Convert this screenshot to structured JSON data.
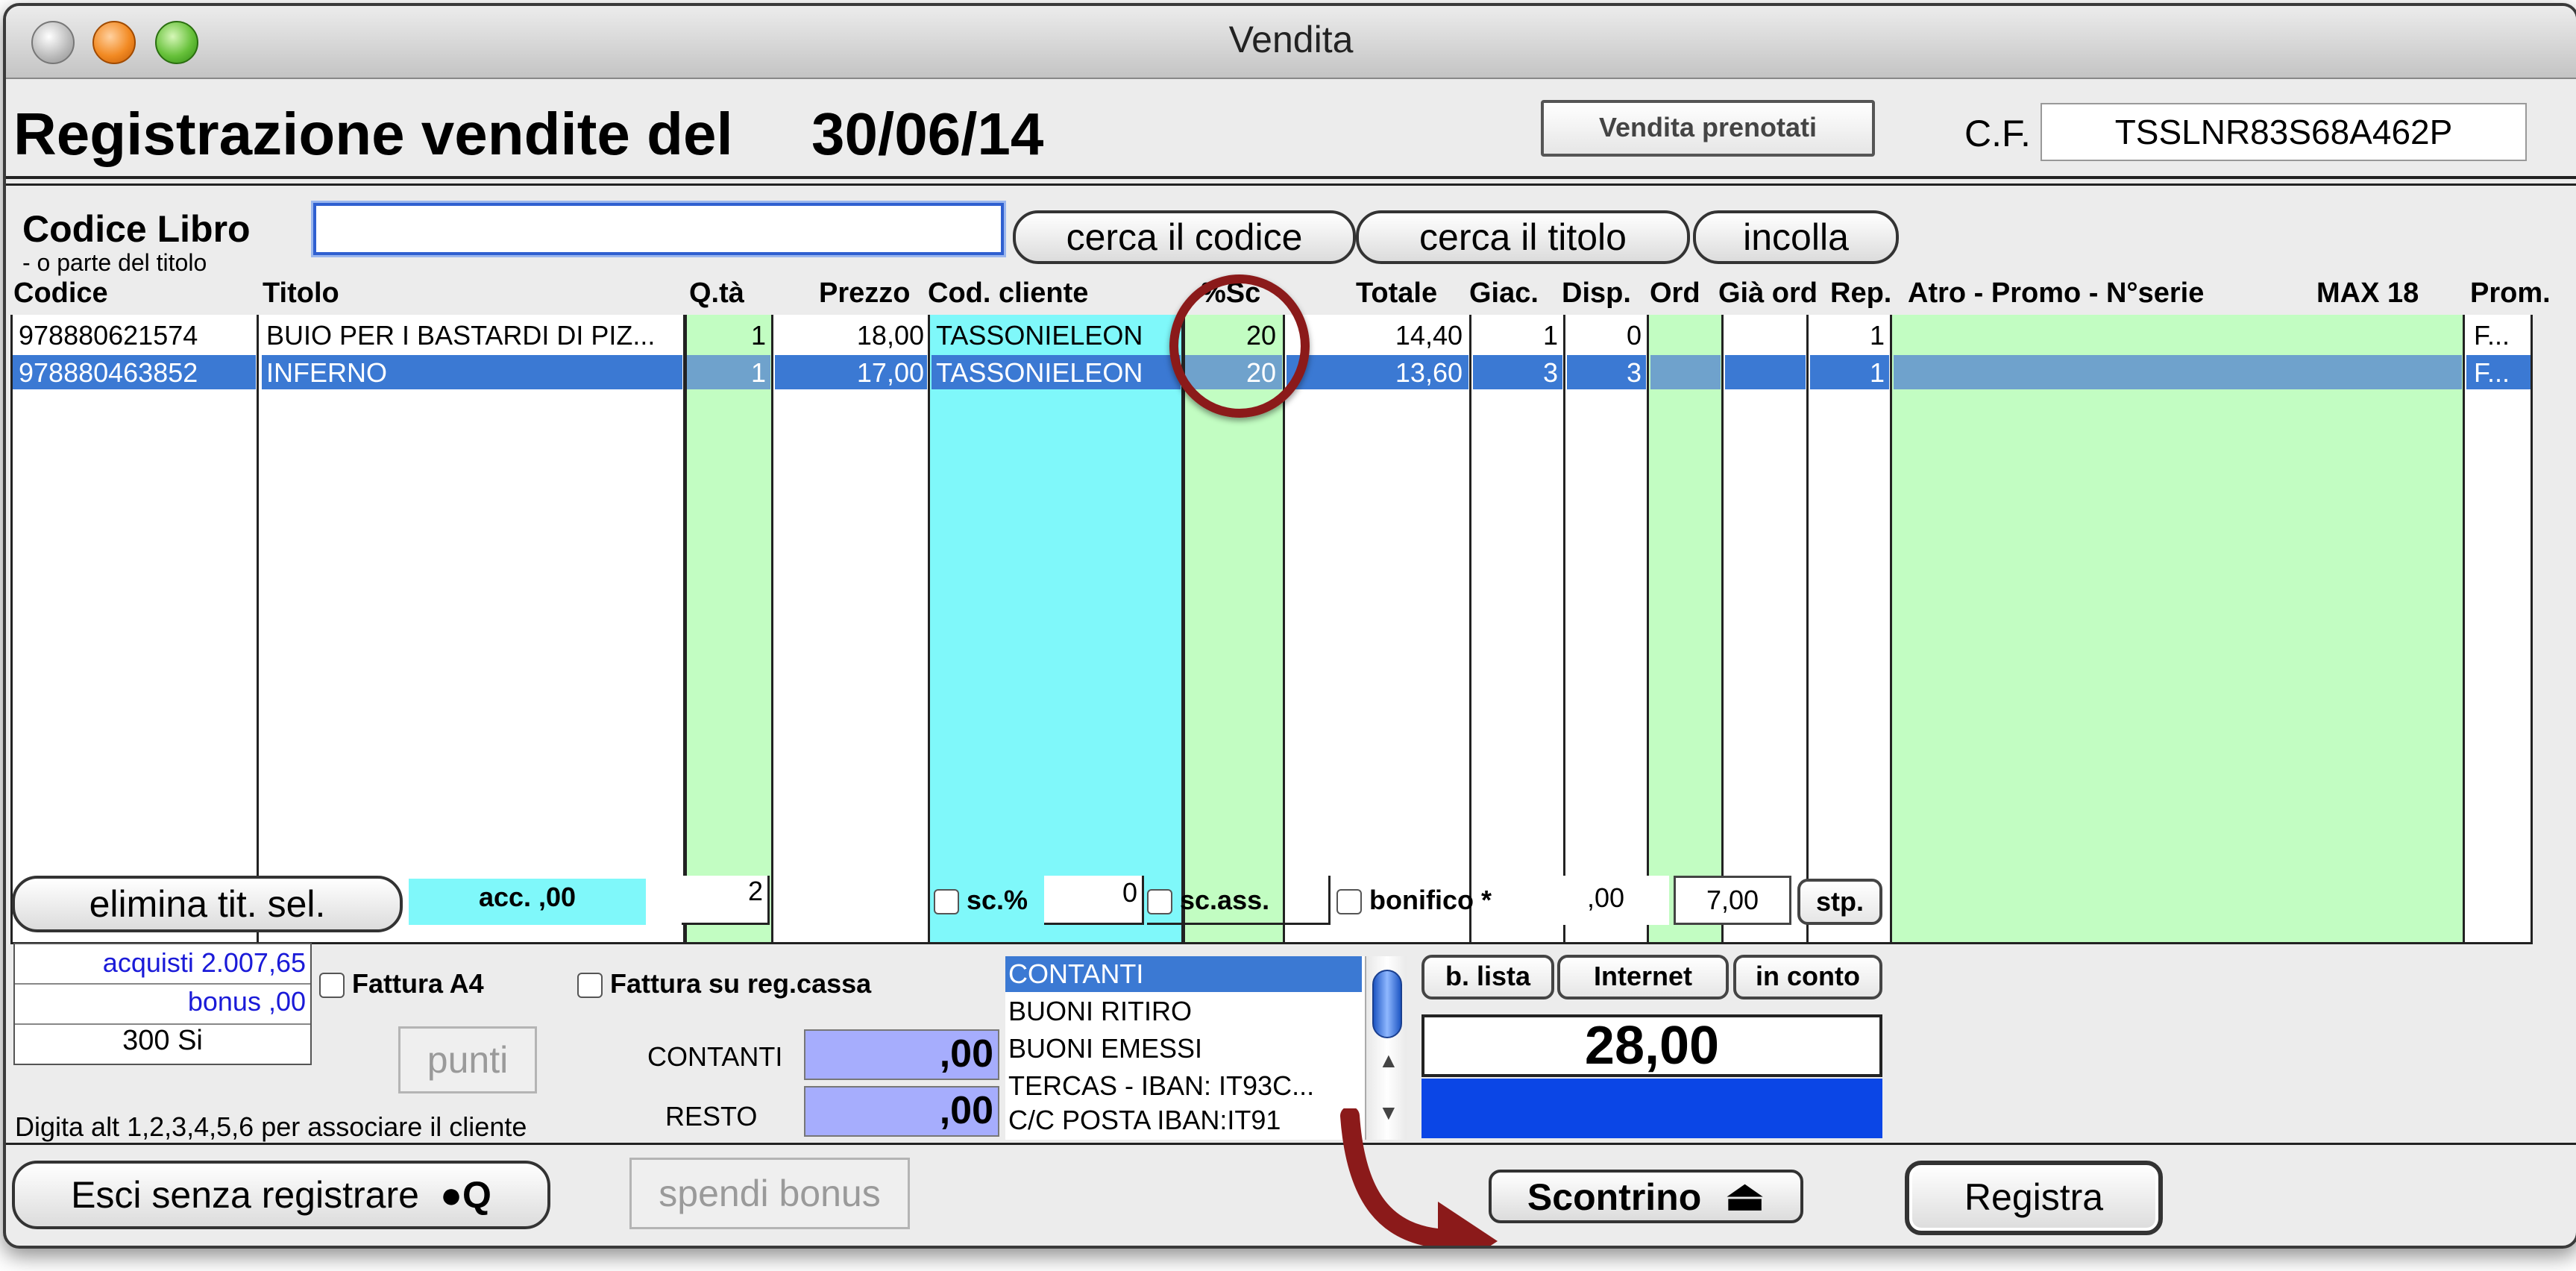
{
  "window": {
    "title": "Vendita"
  },
  "header": {
    "title": "Registrazione vendite del",
    "date": "30/06/14",
    "vendita_prenotati_label": "Vendita prenotati",
    "cf_label": "C.F.",
    "cf_value": "TSSLNR83S68A462P"
  },
  "search": {
    "label": "Codice Libro",
    "sublabel": "- o parte del  titolo",
    "value": "",
    "cerca_codice_label": "cerca il codice",
    "cerca_titolo_label": "cerca il titolo",
    "incolla_label": "incolla"
  },
  "table": {
    "columns": [
      "Codice",
      "Titolo",
      "Q.tà",
      "Prezzo",
      "Cod. cliente",
      "%Sc",
      "Totale",
      "Giac.",
      "Disp.",
      "Ord",
      "Già ord",
      "Rep.",
      "Atro - Promo - N°serie",
      "MAX 18",
      "Prom."
    ],
    "rows": [
      {
        "codice": "978880621574",
        "titolo": "BUIO PER I BASTARDI DI PIZ...",
        "qta": "1",
        "prezzo": "18,00",
        "cod_cliente": "TASSONIELEON",
        "sc": "20",
        "totale": "14,40",
        "giac": "1",
        "disp": "0",
        "rep": "1",
        "prom": "F...",
        "selected": false
      },
      {
        "codice": "978880463852",
        "titolo": "INFERNO",
        "qta": "1",
        "prezzo": "17,00",
        "cod_cliente": "TASSONIELEON",
        "sc": "20",
        "totale": "13,60",
        "giac": "3",
        "disp": "3",
        "rep": "1",
        "prom": "F...",
        "selected": true
      }
    ]
  },
  "footer": {
    "elimina_label": "elimina tit. sel.",
    "acc_value": "acc. ,00",
    "qty_total": "2",
    "sc_perc_label": "sc.%",
    "sc_perc_value": "0",
    "sc_ass_label": "sc.ass.",
    "bonifico_label": "bonifico *",
    "bonifico_value": ",00",
    "spese_value": "7,00",
    "stp_label": "stp."
  },
  "customer": {
    "acquisti": "acquisti 2.007,65",
    "bonus": "bonus ,00",
    "punti_line": "300 Si",
    "punti_button": "punti",
    "fattura_a4": "Fattura A4",
    "fattura_reg": "Fattura su reg.cassa",
    "hint": "Digita alt 1,2,3,4,5,6 per associare il cliente"
  },
  "payment": {
    "contanti_label": "CONTANTI",
    "contanti_value": ",00",
    "resto_label": "RESTO",
    "resto_value": ",00",
    "methods": [
      "CONTANTI",
      "BUONI RITIRO",
      "BUONI EMESSI",
      "TERCAS - IBAN: IT93C...",
      "C/C POSTA IBAN:IT91"
    ],
    "b_lista_label": "b. lista",
    "internet_label": "Internet",
    "in_conto_label": "in conto",
    "total": "28,00"
  },
  "bottom": {
    "esci_label": "Esci senza registrare",
    "esci_shortcut": "Q",
    "spendi_bonus_label": "spendi bonus",
    "scontrino_label": "Scontrino",
    "registra_label": "Registra"
  },
  "colors": {
    "green_col": "#c2fdc2",
    "cyan_col": "#7ff8fa",
    "selection": "#3b79d3",
    "total_bar": "#0b46e6",
    "annotation": "#8b1a1a"
  }
}
